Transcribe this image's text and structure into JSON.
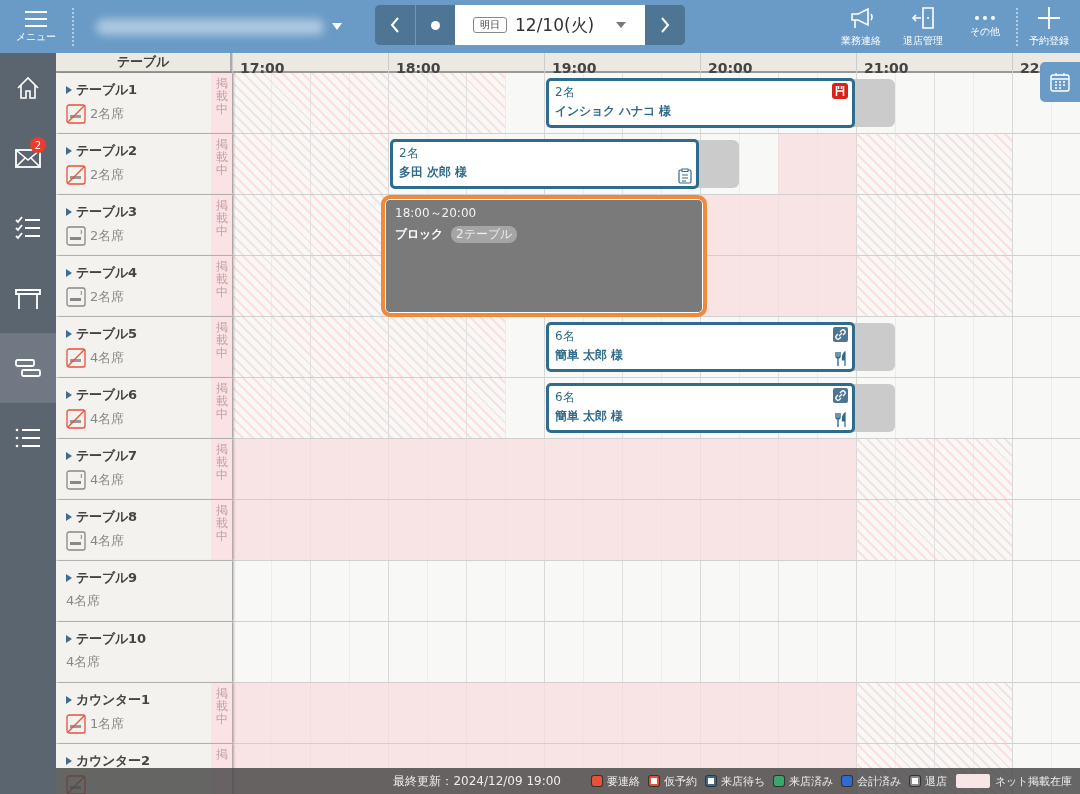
{
  "topbar": {
    "menu_label": "メニュー",
    "date_tag": "明日",
    "date": "12/10(火)",
    "actions": [
      {
        "kind": "notice",
        "label": "業務連絡"
      },
      {
        "kind": "exit",
        "label": "退店管理"
      },
      {
        "kind": "more",
        "label": "その他"
      },
      {
        "kind": "add",
        "label": "予約登録"
      }
    ]
  },
  "sidebar": {
    "items": [
      {
        "kind": "home",
        "selected": false
      },
      {
        "kind": "mail",
        "selected": false,
        "badge": "2"
      },
      {
        "kind": "checklist",
        "selected": false
      },
      {
        "kind": "table",
        "selected": false
      },
      {
        "kind": "timeline",
        "selected": true
      },
      {
        "kind": "list",
        "selected": false
      }
    ]
  },
  "timeline": {
    "column_header": "テーブル",
    "hours": [
      "17:00",
      "18:00",
      "19:00",
      "20:00",
      "21:00",
      "22"
    ]
  },
  "tables": [
    {
      "name": "テーブル1",
      "non_smoking": true,
      "capacity": "2名席",
      "listing": "掲載中",
      "reservations": [
        {
          "kind": "booking",
          "party": "2名",
          "name": "インショク ハナコ 様",
          "icons": [
            {
              "kind": "gourmet"
            }
          ]
        }
      ]
    },
    {
      "name": "テーブル2",
      "non_smoking": true,
      "capacity": "2名席",
      "listing": "掲載中",
      "reservations": [
        {
          "kind": "booking",
          "party": "2名",
          "name": "多田 次郎 様",
          "icons": [
            {
              "kind": "memo"
            }
          ]
        }
      ]
    },
    {
      "name": "テーブル3",
      "non_smoking": false,
      "capacity": "2名席",
      "listing": "掲載中",
      "reservations": [
        {
          "kind": "block",
          "time": "18:00～20:00",
          "label": "ブロック",
          "badge": "2テーブル",
          "selected": true
        }
      ]
    },
    {
      "name": "テーブル4",
      "non_smoking": false,
      "capacity": "2名席",
      "listing": "掲載中"
    },
    {
      "name": "テーブル5",
      "non_smoking": true,
      "capacity": "4名席",
      "listing": "掲載中",
      "reservations": [
        {
          "kind": "booking",
          "party": "6名",
          "name": "簡単 太郎 様",
          "icons": [
            {
              "kind": "link"
            },
            {
              "kind": "cutlery"
            }
          ]
        }
      ]
    },
    {
      "name": "テーブル6",
      "non_smoking": true,
      "capacity": "4名席",
      "listing": "掲載中",
      "reservations": [
        {
          "kind": "booking",
          "party": "6名",
          "name": "簡単 太郎 様",
          "icons": [
            {
              "kind": "link"
            },
            {
              "kind": "cutlery"
            }
          ]
        }
      ]
    },
    {
      "name": "テーブル7",
      "non_smoking": false,
      "capacity": "4名席",
      "listing": "掲載中"
    },
    {
      "name": "テーブル8",
      "non_smoking": false,
      "capacity": "4名席",
      "listing": "掲載中"
    },
    {
      "name": "テーブル9",
      "capacity": "4名席"
    },
    {
      "name": "テーブル10",
      "capacity": "4名席"
    },
    {
      "name": "カウンター1",
      "non_smoking": true,
      "capacity": "1名席",
      "listing": "掲載中"
    },
    {
      "name": "カウンター2",
      "non_smoking": true,
      "listing": "掲"
    }
  ],
  "status_bar": {
    "updated": "最終更新：2024/12/09 19:00",
    "legend": [
      {
        "label": "要連絡",
        "kind": "solid",
        "color": "#e8503a"
      },
      {
        "label": "仮予約",
        "kind": "ring",
        "color": "#e8503a"
      },
      {
        "label": "来店待ち",
        "kind": "ring",
        "color": "#3d6a8d"
      },
      {
        "label": "来店済み",
        "kind": "solid",
        "color": "#3aa66b"
      },
      {
        "label": "会計済み",
        "kind": "solid",
        "color": "#2f6bd1"
      },
      {
        "label": "退店",
        "kind": "ring",
        "color": "#8a8a8a"
      },
      {
        "label": "ネット掲載在庫",
        "kind": "wide",
        "color": "#f8e6e6"
      }
    ]
  }
}
